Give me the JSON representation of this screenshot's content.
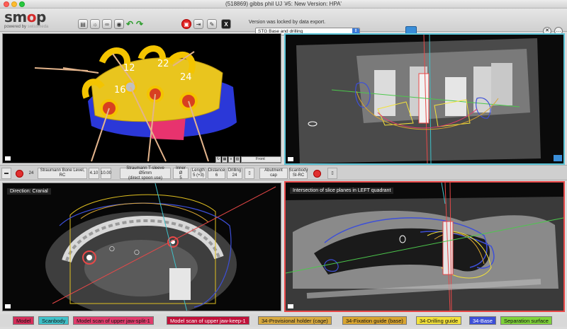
{
  "window": {
    "title": "(518869) gibbs phil UJ  '#5: New Version: HPA'"
  },
  "logo": {
    "main": "smop",
    "sub_prefix": "powered by",
    "sub_brand": "swissmeda"
  },
  "toolbar": {
    "locked_message": "Version was locked by data export.",
    "view_select": "STG Base and drilling",
    "x_label": "X"
  },
  "viewports": {
    "top_left": {
      "labels": [
        {
          "id": "12",
          "text": "12"
        },
        {
          "id": "22",
          "text": "22"
        },
        {
          "id": "24",
          "text": "24"
        },
        {
          "id": "16",
          "text": "16"
        }
      ],
      "view_dropdown": "Front"
    },
    "top_right": {},
    "bottom_left": {
      "label": "Direction: Cranial"
    },
    "bottom_right": {
      "label": "Intersection of slice planes in LEFT quadrant"
    }
  },
  "infobar": {
    "tooth": "24",
    "implant": "Straumann Bone Level, RC",
    "diameter": "4.10",
    "length": "10.00",
    "sleeve_line1": "Straumann T-sleeve Ø5mm",
    "sleeve_line2": "(direct spoon use)",
    "inner_label": "Inner Ø",
    "inner_value": "5",
    "len_label": "Length",
    "len_value": "5 (+3)",
    "dist_label": "Distance",
    "dist_value": "6",
    "drill_label": "Drilling",
    "drill_value": "24",
    "abutment": "Abutment cap",
    "scanbody_label": "Scanbody",
    "scanbody_value": "SI-RC"
  },
  "legend": [
    {
      "label": "Model",
      "color": "#d42e5a",
      "text_color": "#111"
    },
    {
      "label": "Scanbody",
      "color": "#3fc1c9",
      "text_color": "#111"
    },
    {
      "label": "Model scan of upper jaw-split-1",
      "color": "#e03c6c",
      "text_color": "#111"
    },
    {
      "label": "Model scan of upper jaw-keep-1",
      "color": "#c1123a",
      "text_color": "#fff"
    },
    {
      "label": "34-Provisional holder (cage)",
      "color": "#d7a940",
      "text_color": "#111"
    },
    {
      "label": "34-Fixation guide (base)",
      "color": "#d9a531",
      "text_color": "#111"
    },
    {
      "label": "34-Drilling guide",
      "color": "#f2e13a",
      "text_color": "#111"
    },
    {
      "label": "34-Base",
      "color": "#3d4fd8",
      "text_color": "#fff"
    },
    {
      "label": "Separation surface",
      "color": "#7fd23a",
      "text_color": "#111"
    }
  ],
  "colors": {
    "accent_blue": "#3b7ad9",
    "active_cyan": "#5cc5d8",
    "active_red": "#e84848"
  }
}
